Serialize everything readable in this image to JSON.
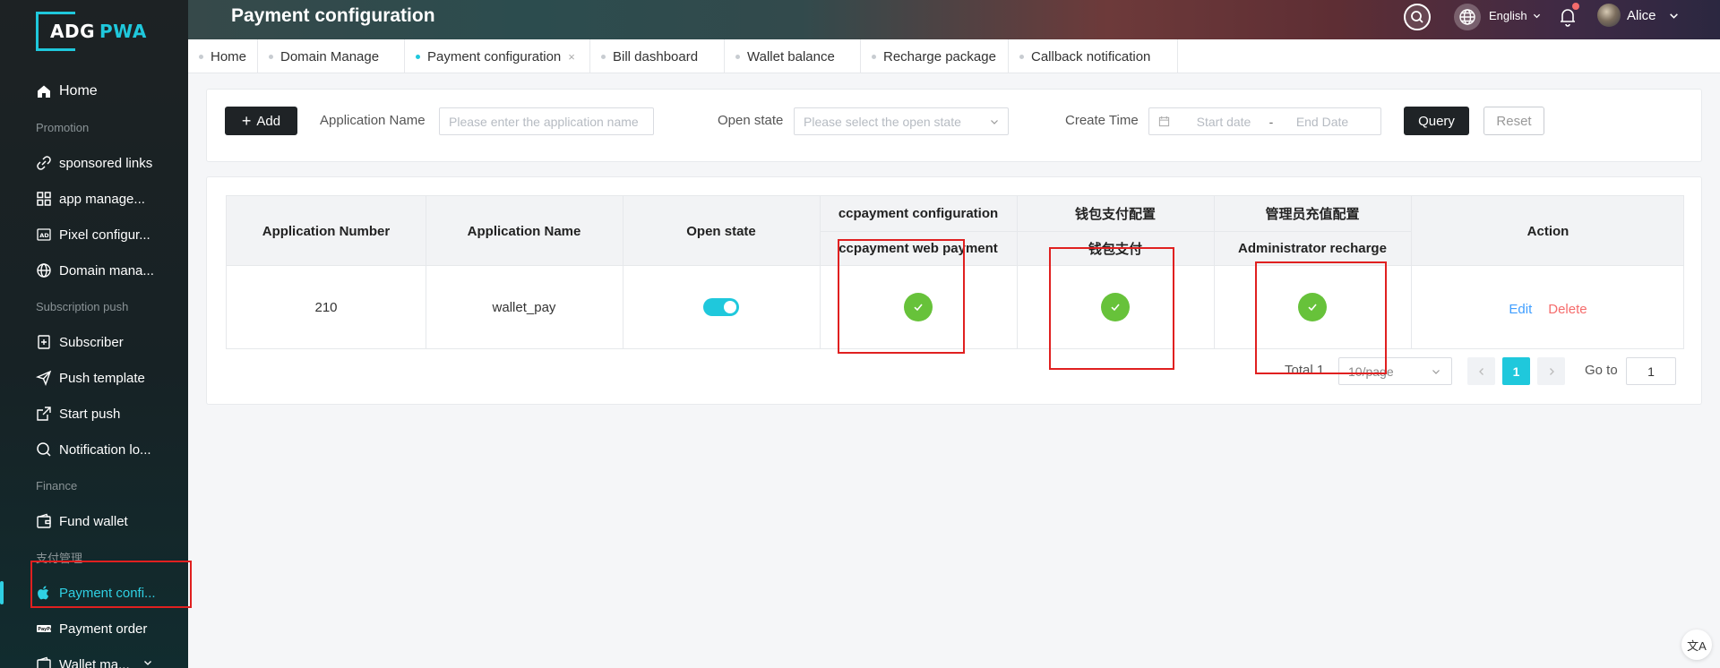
{
  "app": {
    "logo_main": "ADG",
    "logo_accent": "PWA",
    "page_title": "Payment configuration"
  },
  "header": {
    "language": "English",
    "user_name": "Alice"
  },
  "sidebar": {
    "home": "Home",
    "group_promotion": "Promotion",
    "sponsored_links": "sponsored links",
    "app_manage": "app manage...",
    "pixel_config": "Pixel configur...",
    "domain_manage": "Domain mana...",
    "group_subscription": "Subscription push",
    "subscriber": "Subscriber",
    "push_template": "Push template",
    "start_push": "Start push",
    "notification_log": "Notification lo...",
    "group_finance": "Finance",
    "fund_wallet": "Fund wallet",
    "group_payment": "支付管理",
    "payment_config": "Payment confi...",
    "payment_order": "Payment order",
    "wallet_manage": "Wallet ma..."
  },
  "tabs": [
    {
      "label": "Home"
    },
    {
      "label": "Domain Manage"
    },
    {
      "label": "Payment configuration",
      "close": "×"
    },
    {
      "label": "Bill dashboard"
    },
    {
      "label": "Wallet balance"
    },
    {
      "label": "Recharge package"
    },
    {
      "label": "Callback notification"
    }
  ],
  "filters": {
    "add_label": "Add",
    "app_name_label": "Application Name",
    "app_name_placeholder": "Please enter the application name",
    "open_state_label": "Open state",
    "open_state_placeholder": "Please select the open state",
    "create_time_label": "Create Time",
    "start_date": "Start date",
    "date_sep": "-",
    "end_date": "End Date",
    "query_label": "Query",
    "reset_label": "Reset"
  },
  "table": {
    "col_app_number": "Application Number",
    "col_app_name": "Application Name",
    "col_open_state": "Open state",
    "group_ccpayment": "ccpayment configuration",
    "sub_ccpayment_web": "ccpayment web payment",
    "group_wallet": "钱包支付配置",
    "sub_wallet": "钱包支付",
    "group_admin": "管理员充值配置",
    "sub_admin": "Administrator recharge",
    "col_action": "Action",
    "rows": [
      {
        "app_number": "210",
        "app_name": "wallet_pay",
        "open_state": true,
        "ccpayment_web": true,
        "wallet_pay": true,
        "admin_recharge": true,
        "edit": "Edit",
        "delete": "Delete"
      }
    ]
  },
  "pagination": {
    "total": "Total 1",
    "page_size": "10/page",
    "current_page": "1",
    "goto_label": "Go to",
    "goto_value": "1"
  },
  "fab": {
    "translate": "文A"
  },
  "colors": {
    "accent": "#1fc8dc",
    "success": "#67c23a",
    "danger": "#f56c6c",
    "link": "#409eff",
    "highlight": "#e02020"
  }
}
